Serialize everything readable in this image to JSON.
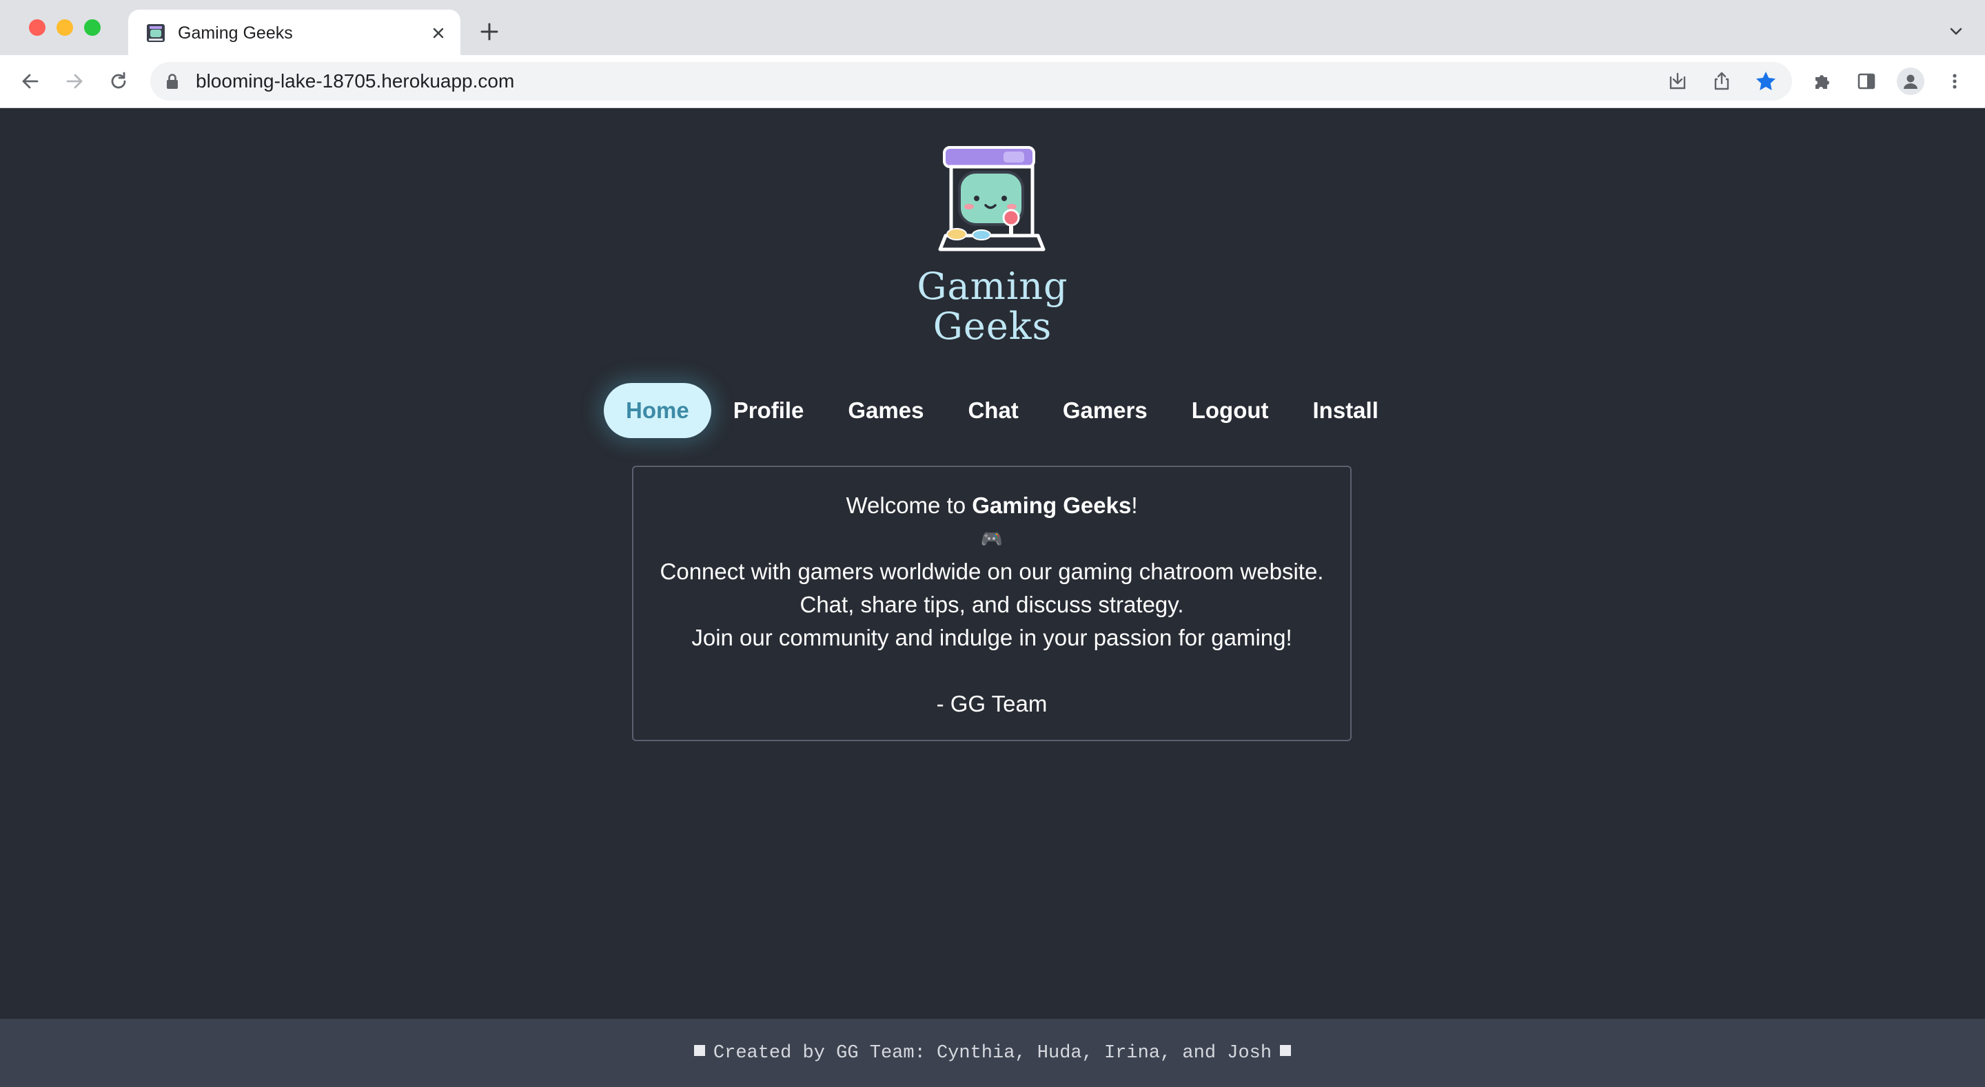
{
  "browser": {
    "tab_title": "Gaming Geeks",
    "url": "blooming-lake-18705.herokuapp.com",
    "accent_color": "#1a73e8"
  },
  "site": {
    "logo_text": "Gaming Geeks",
    "nav": {
      "items": [
        {
          "label": "Home",
          "active": true
        },
        {
          "label": "Profile",
          "active": false
        },
        {
          "label": "Games",
          "active": false
        },
        {
          "label": "Chat",
          "active": false
        },
        {
          "label": "Gamers",
          "active": false
        },
        {
          "label": "Logout",
          "active": false
        },
        {
          "label": "Install",
          "active": false
        }
      ]
    },
    "welcome": {
      "greeting_prefix": "Welcome to ",
      "greeting_brand": "Gaming Geeks",
      "greeting_suffix": "!",
      "emoji": "🎮",
      "line1": "Connect with gamers worldwide on our gaming chatroom website.",
      "line2": "Chat, share tips, and discuss strategy.",
      "line3": "Join our community and indulge in your passion for gaming!",
      "signature": "- GG Team"
    },
    "footer": {
      "text": "Created by GG Team: Cynthia, Huda, Irina, and Josh"
    },
    "colors": {
      "background": "#282c34",
      "nav_active_bg": "#d2f3fb",
      "nav_active_text": "#3d8aa6",
      "footer_bg": "#3d4250"
    }
  }
}
